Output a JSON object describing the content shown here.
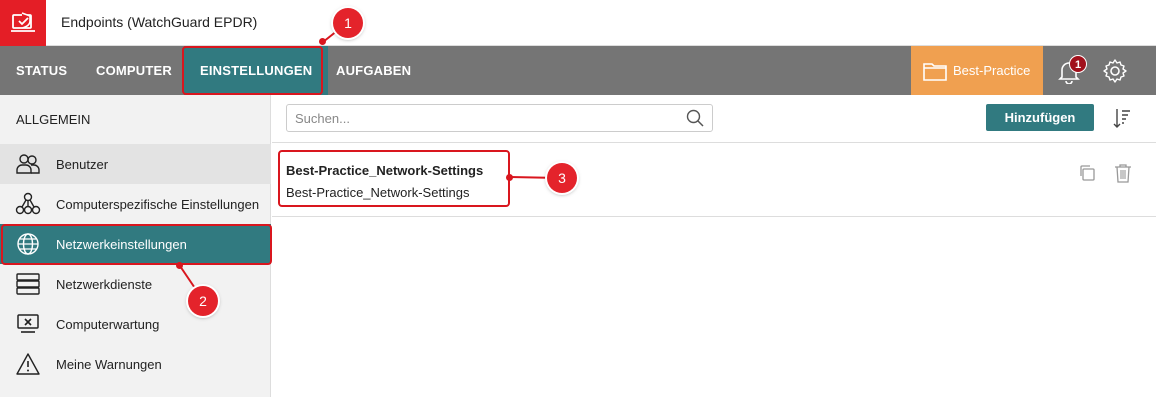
{
  "app": {
    "title": "Endpoints  (WatchGuard EPDR)",
    "brand_color": "#e41e26"
  },
  "nav": {
    "tabs": [
      {
        "label": "STATUS"
      },
      {
        "label": "COMPUTER"
      },
      {
        "label": "EINSTELLUNGEN",
        "active": true
      },
      {
        "label": "AUFGABEN"
      }
    ],
    "filter_label": "Best-Practice",
    "notification_count": "1",
    "bar_color": "#757575",
    "active_color": "#317a80",
    "filter_color": "#f0a050"
  },
  "sidebar": {
    "header": "ALLGEMEIN",
    "items": [
      {
        "label": "Benutzer",
        "icon": "users-icon"
      },
      {
        "label": "Computerspezifische Einstellungen",
        "icon": "network-nodes-icon"
      },
      {
        "label": "Netzwerkeinstellungen",
        "icon": "globe-icon",
        "active": true
      },
      {
        "label": "Netzwerkdienste",
        "icon": "server-icon"
      },
      {
        "label": "Computerwartung",
        "icon": "monitor-x-icon"
      },
      {
        "label": "Meine Warnungen",
        "icon": "warning-icon"
      }
    ]
  },
  "main": {
    "search_placeholder": "Suchen...",
    "add_button": "Hinzufügen",
    "rows": [
      {
        "title": "Best-Practice_Network-Settings",
        "subtitle": "Best-Practice_Network-Settings"
      }
    ]
  },
  "annotations": {
    "markers": [
      "1",
      "2",
      "3"
    ],
    "color": "#e4232b"
  }
}
